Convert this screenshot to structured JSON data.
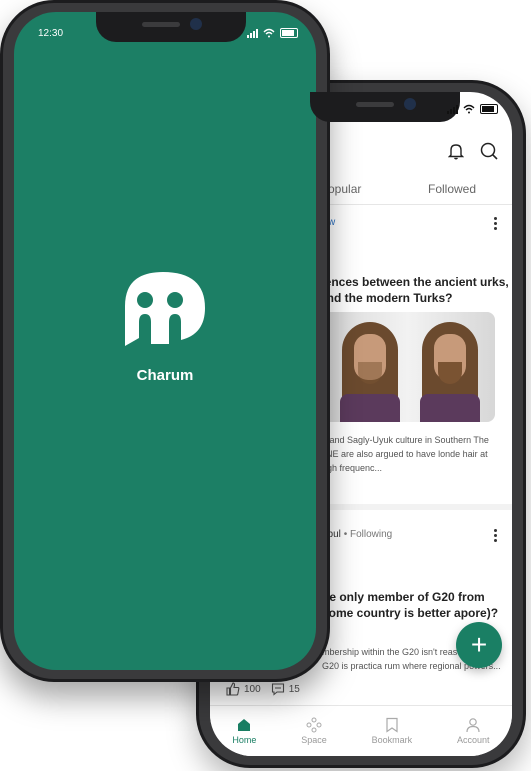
{
  "splash": {
    "status_time": "12:30",
    "brand_name": "Charum",
    "bg_color": "#1c7f65"
  },
  "feed": {
    "tabs": [
      {
        "label": "Popular"
      },
      {
        "label": "Followed"
      }
    ],
    "posts": [
      {
        "meta_action": "llow",
        "title": "rences between the ancient urks, and the modern Turks?",
        "excerpt": "el and Sagly-Uyuk culture in Southern The ANE are also argued to have londe hair at high frequenc..."
      },
      {
        "meta_author": "nbul",
        "meta_status": "Following",
        "title": "he only member of G20 from some country is better apore)?",
        "excerpt": "mbership within the G20 isn't reasons. The G20 is practica rum where regional powers..."
      }
    ],
    "reactions": {
      "likes": "100",
      "comments": "15"
    },
    "nav": [
      {
        "label": "Home"
      },
      {
        "label": "Space"
      },
      {
        "label": "Bookmark"
      },
      {
        "label": "Account"
      }
    ],
    "accent": "#1a7f64"
  }
}
